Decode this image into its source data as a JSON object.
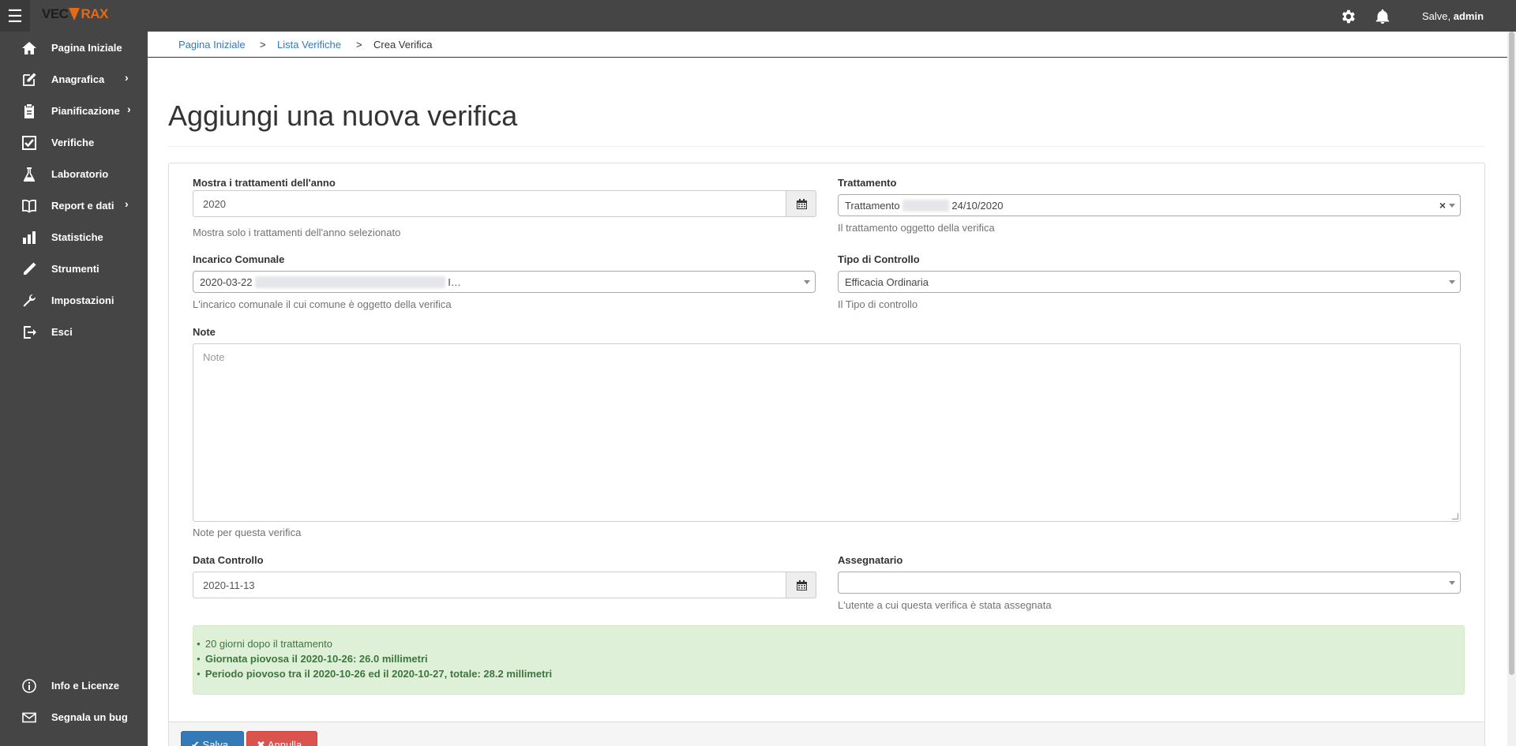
{
  "topbar": {
    "menu_icon": "hamburger-icon",
    "logo": "VECTRAX",
    "logo_parts": {
      "left": "VEC",
      "right": "RAX"
    },
    "settings_icon": "gear-icon",
    "notifications_icon": "bell-icon",
    "greeting_prefix": "Salve,",
    "greeting_user": "admin"
  },
  "sidebar": {
    "items": [
      {
        "label": "Pagina Iniziale",
        "icon": "home-icon",
        "submenu": false
      },
      {
        "label": "Anagrafica",
        "icon": "edit-icon",
        "submenu": true
      },
      {
        "label": "Pianificazione",
        "icon": "clipboard-icon",
        "submenu": true
      },
      {
        "label": "Verifiche",
        "icon": "checkbox-icon",
        "submenu": false
      },
      {
        "label": "Laboratorio",
        "icon": "flask-icon",
        "submenu": false
      },
      {
        "label": "Report e dati",
        "icon": "book-icon",
        "submenu": true
      },
      {
        "label": "Statistiche",
        "icon": "bar-chart-icon",
        "submenu": false
      },
      {
        "label": "Strumenti",
        "icon": "pen-icon",
        "submenu": false
      },
      {
        "label": "Impostazioni",
        "icon": "wrench-icon",
        "submenu": false
      },
      {
        "label": "Esci",
        "icon": "sign-out-icon",
        "submenu": false
      }
    ],
    "bottom_items": [
      {
        "label": "Info e Licenze",
        "icon": "info-icon"
      },
      {
        "label": "Segnala un bug",
        "icon": "envelope-icon"
      }
    ],
    "chevron": "›"
  },
  "breadcrumb": {
    "items": [
      "Pagina Iniziale",
      "Lista Verifiche",
      "Crea Verifica"
    ],
    "separator": ">"
  },
  "page": {
    "title": "Aggiungi una nuova verifica"
  },
  "form": {
    "anno": {
      "label": "Mostra i trattamenti dell'anno",
      "value": "2020",
      "help": "Mostra solo i trattamenti dell'anno selezionato"
    },
    "trattamento": {
      "label": "Trattamento",
      "value_prefix": "Trattamento",
      "value_suffix": "24/10/2020",
      "clear": "×",
      "help": "Il trattamento oggetto della verifica"
    },
    "incarico": {
      "label": "Incarico Comunale",
      "value_prefix": "2020-03-22",
      "value_suffix": "I…",
      "help": "L'incarico comunale il cui comune è oggetto della verifica"
    },
    "tipo": {
      "label": "Tipo di Controllo",
      "value": "Efficacia Ordinaria",
      "help": "Il Tipo di controllo"
    },
    "note": {
      "label": "Note",
      "placeholder": "Note",
      "help": "Note per questa verifica"
    },
    "data": {
      "label": "Data Controllo",
      "value": "2020-11-13"
    },
    "assegnatario": {
      "label": "Assegnatario",
      "value": "",
      "help": "L'utente a cui questa verifica è stata assegnata"
    }
  },
  "alert": {
    "items": [
      "20 giorni dopo il trattamento",
      "Giornata piovosa il 2020-10-26: 26.0 millimetri",
      "Periodo piovoso tra il 2020-10-26 ed il 2020-10-27, totale: 28.2 millimetri"
    ]
  },
  "buttons": {
    "save": "Salva",
    "cancel": "Annulla"
  }
}
